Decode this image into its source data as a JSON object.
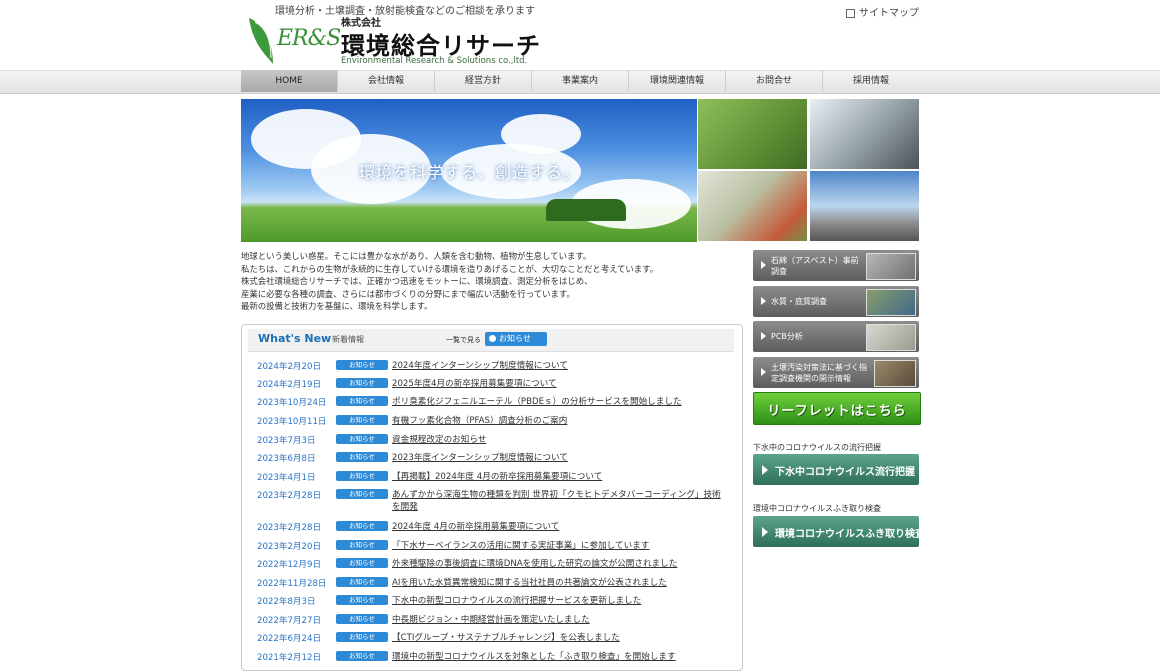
{
  "header": {
    "tagline": "環境分析・土壌調査・放射能検査などのご相談を承ります",
    "logo_mark": "ER&S",
    "company_small": "株式会社",
    "company_name": "環境総合リサーチ",
    "company_en": "Environmental Research & Solutions co.,ltd.",
    "sitemap": "サイトマップ"
  },
  "nav": [
    "HOME",
    "会社情報",
    "経営方針",
    "事業案内",
    "環境関連情報",
    "お問合せ",
    "採用情報"
  ],
  "hero": {
    "copy": "環境を科学する、創造する。"
  },
  "intro": [
    "地球という美しい惑星。そこには豊かな水があり、人類を含む動物、植物が生息しています。",
    "私たちは、これからの生物が永続的に生存していける環境を造りあげることが、大切なことだと考えています。",
    "株式会社環境総合リサーチでは、正確かつ迅速をモットーに、環境調査、測定分析をはじめ、",
    "産業に必要な各種の調査、さらには都市づくりの分野にまで幅広い活動を行っています。",
    "最新の設備と技術力を基盤に、環境を科学します。"
  ],
  "news": {
    "title": "What's New",
    "subtitle": "新着情報",
    "view_all": "一覧で見る",
    "tab": "お知らせ",
    "badge": "お知らせ",
    "items": [
      {
        "date": "2024年2月20日",
        "title": "2024年度インターンシップ制度情報について"
      },
      {
        "date": "2024年2月19日",
        "title": "2025年度4月の新卒採用募集要項について"
      },
      {
        "date": "2023年10月24日",
        "title": "ポリ臭素化ジフェニルエーテル（PBDEｓ）の分析サービスを開始しました"
      },
      {
        "date": "2023年10月11日",
        "title": "有機フッ素化合物（PFAS）調査分析のご案内"
      },
      {
        "date": "2023年7月3日",
        "title": "資金規程改定のお知らせ"
      },
      {
        "date": "2023年6月8日",
        "title": "2023年度インターンシップ制度情報について"
      },
      {
        "date": "2023年4月1日",
        "title": "【再掲載】2024年度 4月の新卒採用募集要項について"
      },
      {
        "date": "2023年2月28日",
        "title": "あんずかから深海生物の種類を判別 世界初「クモヒトデメタバーコーディング」技術を開発"
      },
      {
        "date": "2023年2月28日",
        "title": "2024年度 4月の新卒採用募集要項について"
      },
      {
        "date": "2023年2月20日",
        "title": "「下水サーベイランスの活用に関する実証事業」に参加しています"
      },
      {
        "date": "2022年12月9日",
        "title": "外来種駆除の事後調査に環境DNAを使用した研究の論文が公開されました"
      },
      {
        "date": "2022年11月28日",
        "title": "AIを用いた水質異常検知に関する当社社員の共著論文が公表されました"
      },
      {
        "date": "2022年8月3日",
        "title": "下水中の新型コロナウイルスの流行把握サービスを更新しました"
      },
      {
        "date": "2022年7月27日",
        "title": "中長期ビジョン・中期経営計画を策定いたしました"
      },
      {
        "date": "2022年6月24日",
        "title": "【CTIグループ・サステナブルチャレンジ】を公表しました"
      },
      {
        "date": "2021年2月12日",
        "title": "環境中の新型コロナウイルスを対象とした「ふき取り検査」を開始します"
      }
    ]
  },
  "sidebar": {
    "buttons": [
      {
        "label": "石綿（アスベスト）事前調査"
      },
      {
        "label": "水質・底質調査"
      },
      {
        "label": "PCB分析"
      },
      {
        "label": "土壌汚染対策法に基づく指定調査機関の開示情報"
      }
    ],
    "leaflet": "リーフレットはこちら",
    "section1_label": "下水中のコロナウイルスの流行把握",
    "section1_button": "下水中コロナウイルス流行把握",
    "section2_label": "環境中コロナウイルスふき取り検査",
    "section2_button": "環境コロナウイルスふき取り検査"
  }
}
